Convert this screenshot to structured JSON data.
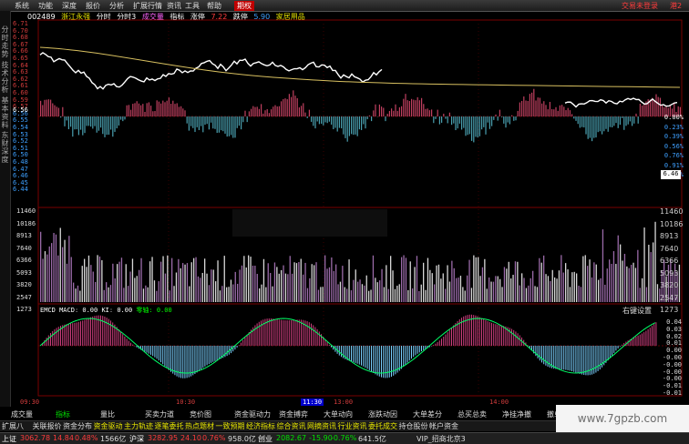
{
  "menu": {
    "items": [
      "系统",
      "功能",
      "深度",
      "报价",
      "分析",
      "扩展行情",
      "资讯",
      "工具",
      "帮助"
    ],
    "active_item": "期权",
    "trade_label": "交易未登录",
    "trade_label_right": "港2"
  },
  "left_tabs": [
    {
      "label": "分时走势"
    },
    {
      "label": "技术分析"
    },
    {
      "label": "基本资料"
    },
    {
      "label": "东财深度"
    }
  ],
  "header": {
    "code": "002489",
    "name": "浙江永强",
    "period": "分时",
    "period3": "分时3",
    "indicator": "成交量",
    "indicator_label": "指标",
    "stop_label": "涨停",
    "stop_up": "7.22",
    "stop_down_label": "跌停",
    "stop_down": "5.90",
    "sector": "家居用品"
  },
  "price_axis": [
    "6.71",
    "6.70",
    "6.68",
    "6.67",
    "6.66",
    "6.65",
    "6.64",
    "6.63",
    "6.62",
    "6.61",
    "6.60",
    "6.59",
    "6.57",
    "6.56",
    "6.55",
    "6.54",
    "6.53",
    "6.52",
    "6.51",
    "6.50",
    "6.48",
    "6.47",
    "6.46",
    "6.45",
    "6.44"
  ],
  "price_axis_current": "6.56",
  "pct_axis": [
    "0.00%",
    "0.23%",
    "0.39%",
    "0.56%",
    "0.76%",
    "0.91%",
    "1.06%"
  ],
  "pct_current": "6.46",
  "vol_axis": [
    "11460",
    "10186",
    "8913",
    "7640",
    "6366",
    "5093",
    "3820",
    "2547",
    "1273"
  ],
  "macd_head": {
    "name": "EMCD MACD",
    "macd_value": "0.00",
    "k_label": "KI",
    "k_value": "0.00",
    "zero_label": "零轴",
    "zero_value": "0.00"
  },
  "macd_axis": [
    "0.04",
    "0.03",
    "0.02",
    "0.01",
    "0.00",
    "-0.00",
    "-0.00",
    "-0.00",
    "-0.00",
    "-0.01",
    "-0.01"
  ],
  "keybtn": "右键设置",
  "time_axis": [
    "09:30",
    "10:30",
    "11:30",
    "13:00",
    "14:00"
  ],
  "toolbar1": [
    "成交量",
    "指标",
    "量比",
    "买卖力道",
    "竞价图",
    "资金驱动力",
    "资金搏弈",
    "大单动向",
    "涨跌动因",
    "大单差分",
    "总买总卖",
    "净挂净撤",
    "撤单累计"
  ],
  "toolbar2": [
    "扩展八",
    "关联报价",
    "资金分布",
    "资金驱动",
    "主力轨迹",
    "逐笔委托",
    "热点题材",
    "一致预期",
    "经济指标",
    "综合资讯",
    "网摘资讯",
    "行业资讯",
    "委托成交",
    "持仓股份",
    "帐户资金"
  ],
  "status": {
    "sh_label": "上证",
    "sh_value": "3062.78",
    "sh_change": "14.84",
    "sh_pct": "0.48%",
    "sh_amount": "1566亿",
    "hs_label": "沪深",
    "hs_value": "3282.95",
    "hs_change": "24.10",
    "hs_pct": "0.76%",
    "hs_amount": "958.0亿",
    "cy_label": "创业",
    "cy_value": "2082.67",
    "cy_change": "-15.90",
    "cy_pct": "-0.76%",
    "cy_amount": "641.5亿",
    "user": "VIP_招商北京3"
  },
  "watermark": "www.7gpzb.com",
  "colors": {
    "up": "#ff3c3c",
    "down": "#00c8c8",
    "price_line": "#ffffff",
    "avg_line": "#d8c060",
    "axis_text": "#d23c3c",
    "pct_text": "#3ea0ff",
    "volume_bar": "#9a6aa8"
  }
}
